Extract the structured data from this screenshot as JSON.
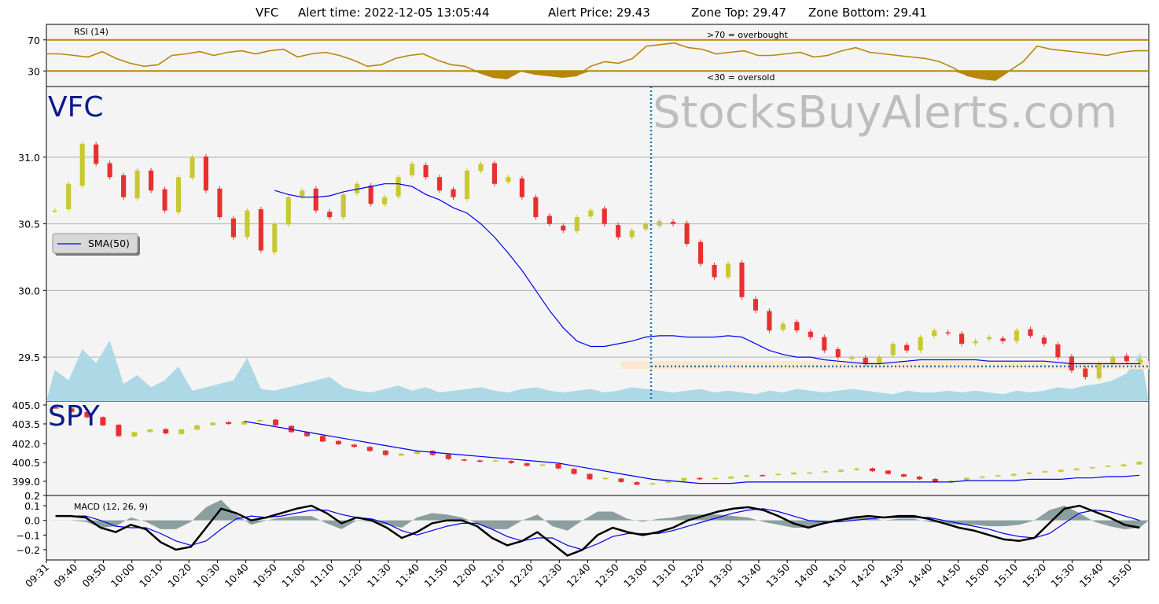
{
  "header": {
    "symbol": "VFC",
    "alert_time": "Alert time: 2022-12-05 13:05:44",
    "alert_price": "Alert Price: 29.43",
    "zone_top": "Zone Top: 29.47",
    "zone_bottom": "Zone Bottom: 29.41"
  },
  "watermark": "StocksBuyAlerts.com",
  "colors": {
    "up": "#c8c832",
    "down": "#e83030",
    "sma": "#0000ee",
    "rsi": "#b8860b",
    "volume": "#add8e6",
    "alert_line": "#1f77b4",
    "zone": "#fde9cf",
    "macd_hist": "#5f7a7a",
    "macd_line": "#000000",
    "signal_line": "#0000ee"
  },
  "chart_data": [
    {
      "type": "line",
      "panel": "rsi",
      "label": "RSI (14)",
      "yticks": [
        "70",
        "30"
      ],
      "ylim": [
        10,
        90
      ],
      "levels": [
        70,
        30
      ],
      "overbought_label": ">70 = overbought",
      "oversold_label": "<30 = oversold",
      "x": [
        0,
        5,
        10,
        15,
        20,
        25,
        30,
        35,
        40,
        45,
        50,
        55,
        60,
        65,
        70,
        75,
        80,
        85,
        90,
        95,
        100,
        105,
        110,
        115,
        120,
        125,
        130,
        135,
        140,
        145,
        150,
        155,
        160,
        165,
        170,
        175,
        180,
        185,
        190,
        195,
        200,
        205,
        210,
        215,
        220,
        225,
        230,
        235,
        240,
        245,
        250,
        255,
        260,
        265,
        270,
        275,
        280,
        285,
        290,
        295,
        300,
        305,
        310,
        315,
        320,
        325,
        330,
        335,
        340,
        345,
        350,
        355,
        360,
        365,
        370,
        375,
        380,
        385,
        390,
        395
      ],
      "values": [
        52,
        52,
        50,
        48,
        55,
        46,
        40,
        36,
        38,
        50,
        52,
        55,
        50,
        54,
        56,
        52,
        56,
        58,
        48,
        52,
        54,
        50,
        44,
        36,
        38,
        46,
        50,
        52,
        44,
        38,
        36,
        28,
        22,
        20,
        30,
        26,
        24,
        22,
        24,
        36,
        42,
        40,
        46,
        62,
        64,
        66,
        60,
        58,
        52,
        54,
        56,
        50,
        50,
        52,
        54,
        48,
        50,
        56,
        60,
        54,
        52,
        50,
        48,
        46,
        42,
        34,
        24,
        20,
        18,
        30,
        42,
        62,
        58,
        56,
        54,
        52,
        50,
        54,
        56,
        56
      ]
    },
    {
      "type": "candlestick",
      "panel": "price",
      "symbol_label": "VFC",
      "legend": "SMA(50)",
      "yticks": [
        "31.0",
        "30.5",
        "30.0",
        "29.5"
      ],
      "ylim": [
        29.17,
        31.53
      ],
      "alert_price": 29.43,
      "zone": [
        29.41,
        29.47
      ],
      "alert_x": 203,
      "close": [
        30.6,
        30.8,
        31.1,
        30.95,
        30.85,
        30.7,
        30.9,
        30.75,
        30.6,
        30.85,
        31.0,
        30.75,
        30.55,
        30.4,
        30.6,
        30.3,
        30.5,
        30.7,
        30.75,
        30.6,
        30.55,
        30.72,
        30.8,
        30.65,
        30.7,
        30.85,
        30.95,
        30.85,
        30.75,
        30.7,
        30.9,
        30.95,
        30.8,
        30.85,
        30.7,
        30.55,
        30.5,
        30.45,
        30.55,
        30.6,
        30.5,
        30.4,
        30.45,
        30.5,
        30.52,
        30.5,
        30.35,
        30.2,
        30.1,
        30.2,
        29.95,
        29.85,
        29.7,
        29.75,
        29.7,
        29.65,
        29.55,
        29.5,
        29.5,
        29.45,
        29.5,
        29.6,
        29.55,
        29.65,
        29.7,
        29.68,
        29.6,
        29.62,
        29.65,
        29.62,
        29.7,
        29.66,
        29.6,
        29.5,
        29.4,
        29.35,
        29.45,
        29.5,
        29.47,
        29.48
      ],
      "sma": [
        null,
        null,
        null,
        null,
        null,
        null,
        null,
        null,
        null,
        null,
        null,
        null,
        null,
        null,
        null,
        null,
        30.75,
        30.72,
        30.7,
        30.7,
        30.71,
        30.74,
        30.76,
        30.78,
        30.8,
        30.8,
        30.78,
        30.72,
        30.68,
        30.62,
        30.58,
        30.5,
        30.4,
        30.28,
        30.15,
        30.0,
        29.85,
        29.72,
        29.62,
        29.58,
        29.58,
        29.6,
        29.62,
        29.65,
        29.66,
        29.66,
        29.65,
        29.65,
        29.65,
        29.66,
        29.65,
        29.6,
        29.55,
        29.52,
        29.5,
        29.5,
        29.48,
        29.47,
        29.46,
        29.45,
        29.45,
        29.46,
        29.47,
        29.48,
        29.48,
        29.48,
        29.48,
        29.48,
        29.47,
        29.47,
        29.47,
        29.47,
        29.47,
        29.46,
        29.45,
        29.45,
        29.45,
        29.45,
        29.45,
        29.45
      ],
      "volume": [
        18,
        12,
        30,
        22,
        35,
        10,
        15,
        8,
        12,
        20,
        6,
        8,
        10,
        12,
        25,
        7,
        6,
        8,
        10,
        12,
        14,
        8,
        6,
        5,
        7,
        9,
        6,
        8,
        5,
        6,
        7,
        8,
        6,
        5,
        7,
        8,
        6,
        5,
        6,
        7,
        5,
        6,
        8,
        7,
        6,
        5,
        6,
        7,
        5,
        6,
        5,
        4,
        6,
        5,
        7,
        6,
        5,
        6,
        7,
        6,
        5,
        4,
        6,
        5,
        5,
        6,
        5,
        6,
        5,
        4,
        6,
        5,
        6,
        8,
        7,
        9,
        10,
        12,
        16,
        28
      ]
    },
    {
      "type": "candlestick",
      "panel": "spy",
      "symbol_label": "SPY",
      "yticks": [
        "405.0",
        "403.5",
        "402.0",
        "400.5",
        "399.0",
        "0.2"
      ],
      "ylim": [
        398.0,
        405.0
      ],
      "close": [
        404.5,
        404.2,
        403.8,
        403.2,
        402.4,
        402.7,
        402.9,
        402.6,
        402.9,
        403.2,
        403.4,
        403.3,
        403.5,
        403.6,
        403.2,
        402.7,
        402.4,
        402.0,
        401.8,
        401.6,
        401.3,
        401.0,
        401.1,
        401.3,
        401.0,
        400.7,
        400.6,
        400.5,
        400.6,
        400.4,
        400.2,
        400.3,
        400.0,
        399.6,
        399.2,
        399.3,
        399.0,
        398.8,
        398.9,
        399.1,
        399.3,
        399.2,
        399.3,
        399.4,
        399.5,
        399.5,
        399.6,
        399.7,
        399.7,
        399.8,
        399.9,
        400.0,
        399.8,
        399.6,
        399.4,
        399.2,
        399.0,
        399.1,
        399.3,
        399.4,
        399.5,
        399.6,
        399.7,
        399.8,
        399.9,
        400.0,
        400.1,
        400.2,
        400.3,
        400.5
      ],
      "sma": [
        null,
        null,
        null,
        null,
        null,
        null,
        null,
        null,
        null,
        null,
        null,
        null,
        403.5,
        403.3,
        403.1,
        402.9,
        402.7,
        402.5,
        402.3,
        402.1,
        401.9,
        401.7,
        401.5,
        401.3,
        401.2,
        401.1,
        401.0,
        400.9,
        400.8,
        400.7,
        400.6,
        400.5,
        400.4,
        400.2,
        400.0,
        399.8,
        399.6,
        399.4,
        399.2,
        399.1,
        399.0,
        398.9,
        398.9,
        398.9,
        399.0,
        399.0,
        399.0,
        399.0,
        399.0,
        399.0,
        399.0,
        399.0,
        399.0,
        399.0,
        399.0,
        399.0,
        399.0,
        399.0,
        399.1,
        399.1,
        399.1,
        399.1,
        399.2,
        399.2,
        399.2,
        399.3,
        399.3,
        399.4,
        399.4,
        399.5
      ]
    },
    {
      "type": "line",
      "panel": "macd",
      "label": "MACD (12, 26, 9)",
      "yticks": [
        "0.1",
        "0.0",
        "−0.1",
        "−0.2"
      ],
      "ylim": [
        -0.27,
        0.17
      ],
      "macd": [
        0.03,
        0.03,
        0.02,
        -0.05,
        -0.08,
        -0.03,
        -0.06,
        -0.15,
        -0.2,
        -0.18,
        -0.05,
        0.08,
        0.05,
        0.0,
        0.02,
        0.05,
        0.08,
        0.1,
        0.05,
        -0.02,
        0.02,
        0.0,
        -0.05,
        -0.12,
        -0.08,
        -0.02,
        0.0,
        0.0,
        -0.04,
        -0.12,
        -0.17,
        -0.14,
        -0.08,
        -0.16,
        -0.24,
        -0.2,
        -0.1,
        -0.05,
        -0.08,
        -0.1,
        -0.08,
        -0.05,
        0.0,
        0.03,
        0.06,
        0.08,
        0.09,
        0.07,
        0.03,
        -0.02,
        -0.05,
        -0.02,
        0.0,
        0.02,
        0.03,
        0.02,
        0.03,
        0.03,
        0.01,
        -0.02,
        -0.05,
        -0.07,
        -0.1,
        -0.13,
        -0.14,
        -0.12,
        -0.02,
        0.08,
        0.1,
        0.06,
        0.02,
        -0.03,
        -0.05
      ],
      "signal": [
        0.03,
        0.03,
        0.03,
        0.0,
        -0.04,
        -0.05,
        -0.05,
        -0.09,
        -0.14,
        -0.17,
        -0.14,
        -0.06,
        0.01,
        0.03,
        0.02,
        0.03,
        0.05,
        0.07,
        0.07,
        0.04,
        0.02,
        0.01,
        -0.02,
        -0.07,
        -0.1,
        -0.07,
        -0.04,
        -0.02,
        -0.02,
        -0.06,
        -0.11,
        -0.14,
        -0.12,
        -0.12,
        -0.17,
        -0.2,
        -0.16,
        -0.11,
        -0.09,
        -0.09,
        -0.09,
        -0.07,
        -0.04,
        -0.01,
        0.02,
        0.05,
        0.07,
        0.08,
        0.06,
        0.03,
        0.0,
        -0.01,
        -0.01,
        0.0,
        0.01,
        0.02,
        0.02,
        0.02,
        0.02,
        0.0,
        -0.02,
        -0.04,
        -0.06,
        -0.09,
        -0.11,
        -0.12,
        -0.09,
        -0.02,
        0.05,
        0.07,
        0.06,
        0.03,
        0.0
      ]
    }
  ],
  "x_ticks": [
    "09:31",
    "09:40",
    "09:50",
    "10:00",
    "10:10",
    "10:20",
    "10:30",
    "10:40",
    "10:50",
    "11:00",
    "11:10",
    "11:20",
    "11:30",
    "11:40",
    "11:50",
    "12:00",
    "12:10",
    "12:20",
    "12:30",
    "12:40",
    "12:50",
    "13:00",
    "13:10",
    "13:20",
    "13:30",
    "13:40",
    "13:50",
    "14:00",
    "14:10",
    "14:20",
    "14:30",
    "14:40",
    "14:50",
    "15:00",
    "15:10",
    "15:20",
    "15:30",
    "15:40",
    "15:50"
  ]
}
